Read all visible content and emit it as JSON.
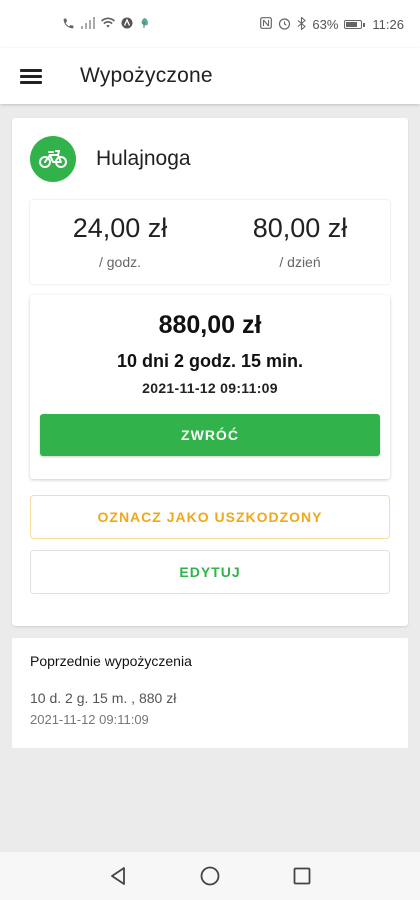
{
  "status_bar": {
    "battery": "63%",
    "time": "11:26"
  },
  "app_bar": {
    "title": "Wypożyczone"
  },
  "vehicle": {
    "name": "Hulajnoga",
    "icon": "bicycle-icon"
  },
  "rates": [
    {
      "value": "24,00 zł",
      "unit": "/ godz."
    },
    {
      "value": "80,00 zł",
      "unit": "/ dzień"
    }
  ],
  "summary": {
    "total": "880,00 zł",
    "duration": "10 dni 2 godz. 15 min.",
    "timestamp": "2021-11-12 09:11:09"
  },
  "buttons": {
    "return_label": "ZWRÓĆ",
    "damaged_label": "OZNACZ JAKO USZKODZONY",
    "edit_label": "EDYTUJ"
  },
  "history": {
    "title": "Poprzednie wypożyczenia",
    "items": [
      {
        "summary": "10 d. 2 g. 15 m. , 880 zł",
        "date": "2021-11-12 09:11:09"
      }
    ]
  },
  "colors": {
    "primary_green": "#32b24a",
    "warning_orange": "#f0a818",
    "background": "#ebebeb"
  }
}
